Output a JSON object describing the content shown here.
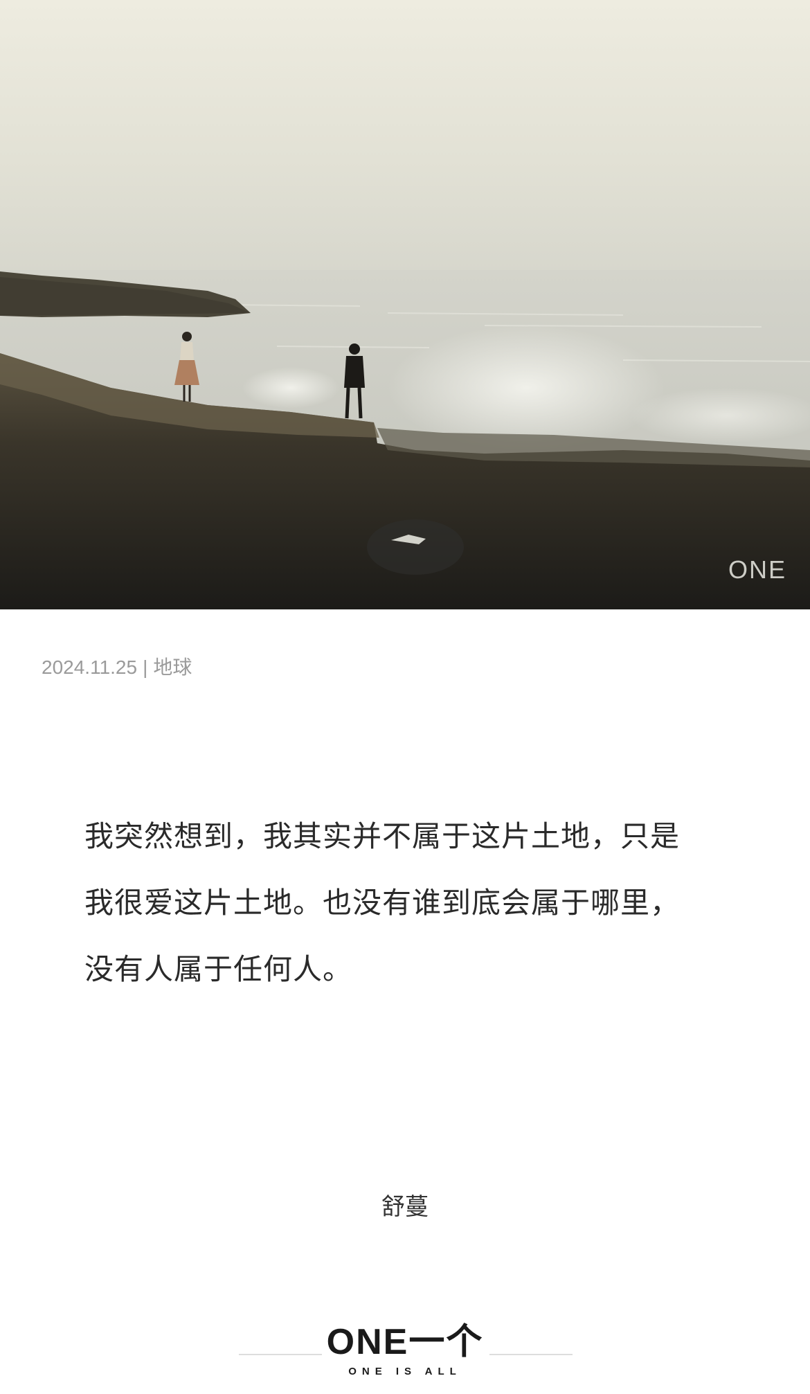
{
  "hero": {
    "watermark": "ONE",
    "description_icon": "landscape-photo"
  },
  "meta": {
    "date": "2024.11.25",
    "separator": "|",
    "location": "地球"
  },
  "quote": {
    "lines": [
      "我突然想到，我其实并不属于这片土地，只是",
      "我很爱这片土地。也没有谁到底会属于哪里，",
      "没有人属于任何人。"
    ]
  },
  "author": "舒蔓",
  "footer": {
    "logo": "ONE一个",
    "tagline": "ONE IS ALL"
  },
  "colors": {
    "sky": "#e6e4d6",
    "sea": "#d8d8cf",
    "rock": "#2a2620",
    "meta_text": "#9a9a9a",
    "body_text": "#2a2a2a"
  }
}
